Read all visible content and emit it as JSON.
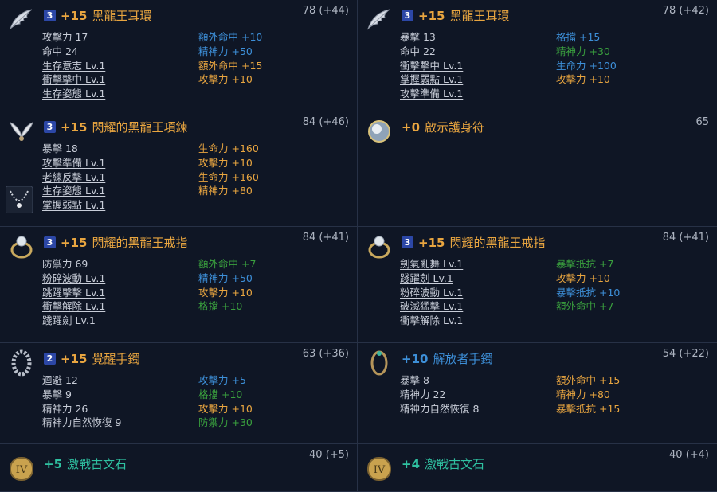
{
  "items": [
    {
      "icon": "wing-earring-icon",
      "tier": "3",
      "plus": "+15",
      "name": "黑龍王耳環",
      "name_color": "#e8a540",
      "score": "78 (+44)",
      "base": [
        "攻擊力 17",
        "命中 24"
      ],
      "skills": [
        "生存意志 Lv.1",
        "衝擊擊中 Lv.1",
        "生存姿態 Lv.1"
      ],
      "bonus": [
        {
          "text": "額外命中 +10",
          "color": "blue"
        },
        {
          "text": "精神力 +50",
          "color": "blue"
        },
        {
          "text": "額外命中 +15",
          "color": "orange"
        },
        {
          "text": "攻擊力 +10",
          "color": "orange"
        }
      ]
    },
    {
      "icon": "wing-earring-icon",
      "tier": "3",
      "plus": "+15",
      "name": "黑龍王耳環",
      "name_color": "#e8a540",
      "score": "78 (+42)",
      "base": [
        "暴擊 13",
        "命中 22"
      ],
      "skills": [
        "衝擊擊中 Lv.1",
        "掌握弱點 Lv.1",
        "攻擊準備 Lv.1"
      ],
      "bonus": [
        {
          "text": "格擋 +15",
          "color": "blue"
        },
        {
          "text": "精神力 +30",
          "color": "green"
        },
        {
          "text": "生命力 +100",
          "color": "blue"
        },
        {
          "text": "攻擊力 +10",
          "color": "orange"
        }
      ]
    },
    {
      "icon": "wing-necklace-icon",
      "tier": "3",
      "plus": "+15",
      "name": "閃耀的黑龍王項鍊",
      "name_color": "#e8a540",
      "score": "84 (+46)",
      "base": [
        "暴擊 18"
      ],
      "skills": [
        "攻擊準備 Lv.1",
        "老練反擊 Lv.1",
        "生存姿態 Lv.1",
        "掌握弱點 Lv.1"
      ],
      "bonus": [
        {
          "text": "生命力 +160",
          "color": "orange"
        },
        {
          "text": "攻擊力 +10",
          "color": "orange"
        },
        {
          "text": "生命力 +160",
          "color": "orange"
        },
        {
          "text": "精神力 +80",
          "color": "orange"
        }
      ],
      "icon2": "necklace-chain-icon"
    },
    {
      "icon": "orb-amulet-icon",
      "tier": "",
      "plus": "+0",
      "name": "啟示護身符",
      "name_color": "#e8a540",
      "score": "65",
      "base": [],
      "skills": [],
      "bonus": []
    },
    {
      "icon": "pearl-ring-icon",
      "tier": "3",
      "plus": "+15",
      "name": "閃耀的黑龍王戒指",
      "name_color": "#e8a540",
      "score": "84 (+41)",
      "base": [
        "防禦力 69"
      ],
      "skills": [
        "粉碎波動 Lv.1",
        "跳躍擊擊 Lv.1",
        "衝擊解除 Lv.1",
        "踐躍劍 Lv.1"
      ],
      "bonus": [
        {
          "text": "額外命中 +7",
          "color": "green"
        },
        {
          "text": "精神力 +50",
          "color": "blue"
        },
        {
          "text": "攻擊力 +10",
          "color": "orange"
        },
        {
          "text": "格擋 +10",
          "color": "green"
        }
      ]
    },
    {
      "icon": "pearl-ring-icon",
      "tier": "3",
      "plus": "+15",
      "name": "閃耀的黑龍王戒指",
      "name_color": "#e8a540",
      "score": "84 (+41)",
      "base": [],
      "skills": [
        "劍氣亂舞 Lv.1",
        "踐躍劍 Lv.1",
        "粉碎波動 Lv.1",
        "破滅猛擊 Lv.1",
        "衝擊解除 Lv.1"
      ],
      "bonus": [
        {
          "text": "暴擊抵抗 +7",
          "color": "green"
        },
        {
          "text": "攻擊力 +10",
          "color": "orange"
        },
        {
          "text": "暴擊抵抗 +10",
          "color": "blue"
        },
        {
          "text": "額外命中 +7",
          "color": "green"
        }
      ]
    },
    {
      "icon": "chain-bracelet-icon",
      "tier": "2",
      "plus": "+15",
      "name": "覺醒手鐲",
      "name_color": "#e8a540",
      "score": "63 (+36)",
      "base": [
        "迴避 12",
        "暴擊 9",
        "精神力 26",
        "精神力自然恢復 9"
      ],
      "skills": [],
      "bonus": [
        {
          "text": "攻擊力 +5",
          "color": "blue"
        },
        {
          "text": "格擋 +10",
          "color": "green"
        },
        {
          "text": "攻擊力 +10",
          "color": "orange"
        },
        {
          "text": "防禦力 +30",
          "color": "green"
        }
      ]
    },
    {
      "icon": "gem-bracelet-icon",
      "tier": "",
      "plus": "+10",
      "name": "解放者手鐲",
      "name_color": "#3d8fd8",
      "score": "54 (+22)",
      "base": [
        "暴擊 8",
        "精神力 22",
        "精神力自然恢復 8"
      ],
      "skills": [],
      "bonus": [
        {
          "text": "額外命中 +15",
          "color": "orange"
        },
        {
          "text": "精神力 +80",
          "color": "orange"
        },
        {
          "text": "暴擊抵抗 +15",
          "color": "orange"
        }
      ]
    },
    {
      "icon": "rune-stone-icon",
      "tier": "",
      "plus": "+5",
      "name": "激戰古文石",
      "name_color": "#2fc1a1",
      "score": "40 (+5)",
      "base": [],
      "skills": [],
      "bonus": []
    },
    {
      "icon": "rune-stone-icon",
      "tier": "",
      "plus": "+4",
      "name": "激戰古文石",
      "name_color": "#2fc1a1",
      "score": "40 (+4)",
      "base": [],
      "skills": [],
      "bonus": []
    }
  ]
}
